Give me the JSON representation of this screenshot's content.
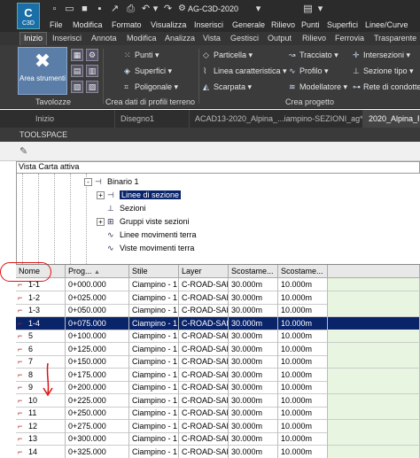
{
  "app": {
    "logo_text": "C",
    "logo_sub": "C3D",
    "workspace": "AG-C3D-2020"
  },
  "menu": [
    "File",
    "Modifica",
    "Formato",
    "Visualizza",
    "Inserisci",
    "Generale",
    "Rilievo",
    "Punti",
    "Superfici",
    "Linee/Curve"
  ],
  "ribbon_tabs": [
    "Inizio",
    "Inserisci",
    "Annota",
    "Modifica",
    "Analizza",
    "Vista",
    "Gestisci",
    "Output",
    "Rilievo",
    "Ferrovia",
    "Trasparente"
  ],
  "ribbon": {
    "area_strumenti": "Area strumenti",
    "punti": "Punti",
    "superfici": "Superfici",
    "poligonale": "Poligonale",
    "particella": "Particella",
    "linea_caratteristica": "Linea caratteristica",
    "scarpata": "Scarpata",
    "tracciato": "Tracciato",
    "profilo": "Profilo",
    "modellatore": "Modellatore",
    "intersezioni": "Intersezioni",
    "sezione_tipo": "Sezione tipo",
    "rete_condotte": "Rete di condotte",
    "group_tavolozze": "Tavolozze",
    "group_crea_dati": "Crea dati di profili terreno",
    "group_crea_progetto": "Crea progetto"
  },
  "doc_tabs": [
    "Inizio",
    "Disegno1",
    "ACAD13-2020_Alpina_...iampino-SEZIONI_ag*",
    "2020_Alpina_R"
  ],
  "toolspace": {
    "title": "TOOLSPACE",
    "view": "Vista Carta attiva"
  },
  "tree": [
    {
      "label": "Binario 1",
      "expander": "-"
    },
    {
      "label": "Linee di sezione",
      "expander": "+"
    },
    {
      "label": "Sezioni",
      "expander": ""
    },
    {
      "label": "Gruppi viste sezioni",
      "expander": "+"
    },
    {
      "label": "Linee movimenti terra",
      "expander": ""
    },
    {
      "label": "Viste movimenti terra",
      "expander": ""
    }
  ],
  "grid": {
    "headers": [
      "Nome",
      "Prog...",
      "Stile",
      "Layer",
      "Scostame...",
      "Scostame..."
    ],
    "sort_arrow": "▲",
    "rows": [
      [
        "1-1",
        "0+000.000",
        "Ciampino - 1",
        "C-ROAD-SAMI",
        "30.000m",
        "10.000m"
      ],
      [
        "1-2",
        "0+025.000",
        "Ciampino - 1",
        "C-ROAD-SAMI",
        "30.000m",
        "10.000m"
      ],
      [
        "1-3",
        "0+050.000",
        "Ciampino - 1",
        "C-ROAD-SAMI",
        "30.000m",
        "10.000m"
      ],
      [
        "1-4",
        "0+075.000",
        "Ciampino - 1",
        "C-ROAD-SAMI",
        "30.000m",
        "10.000m"
      ],
      [
        "5",
        "0+100.000",
        "Ciampino - 1",
        "C-ROAD-SAMI",
        "30.000m",
        "10.000m"
      ],
      [
        "6",
        "0+125.000",
        "Ciampino - 1",
        "C-ROAD-SAMI",
        "30.000m",
        "10.000m"
      ],
      [
        "7",
        "0+150.000",
        "Ciampino - 1",
        "C-ROAD-SAMI",
        "30.000m",
        "10.000m"
      ],
      [
        "8",
        "0+175.000",
        "Ciampino - 1",
        "C-ROAD-SAMI",
        "30.000m",
        "10.000m"
      ],
      [
        "9",
        "0+200.000",
        "Ciampino - 1",
        "C-ROAD-SAMI",
        "30.000m",
        "10.000m"
      ],
      [
        "10",
        "0+225.000",
        "Ciampino - 1",
        "C-ROAD-SAMI",
        "30.000m",
        "10.000m"
      ],
      [
        "11",
        "0+250.000",
        "Ciampino - 1",
        "C-ROAD-SAMI",
        "30.000m",
        "10.000m"
      ],
      [
        "12",
        "0+275.000",
        "Ciampino - 1",
        "C-ROAD-SAMI",
        "30.000m",
        "10.000m"
      ],
      [
        "13",
        "0+300.000",
        "Ciampino - 1",
        "C-ROAD-SAMI",
        "30.000m",
        "10.000m"
      ],
      [
        "14",
        "0+325.000",
        "Ciampino - 1",
        "C-ROAD-SAMI",
        "30.000m",
        "10.000m"
      ]
    ]
  },
  "colors": {
    "selected_row": "#0a246a",
    "annotation": "#d11111",
    "green_cell": "#e8f5e0"
  }
}
